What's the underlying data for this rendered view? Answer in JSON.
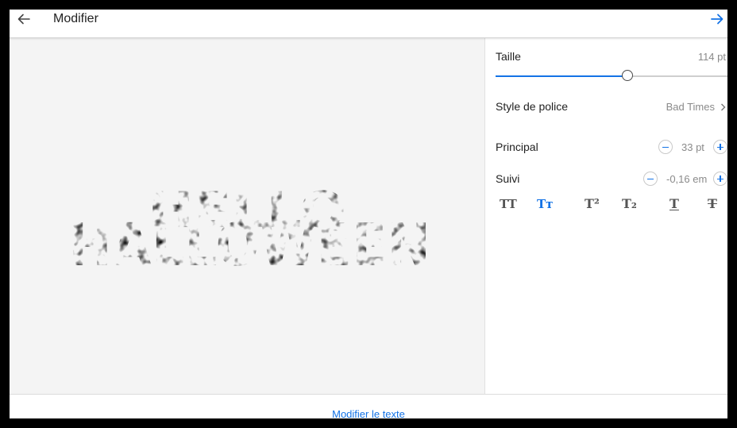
{
  "header": {
    "title": "Modifier",
    "back_icon": "arrow-left-icon",
    "forward_icon": "arrow-right-icon"
  },
  "canvas": {
    "text_line1": "HELLO",
    "text_line2": "HALLOWEEN"
  },
  "panel": {
    "size": {
      "label": "Taille",
      "value": "114 pt",
      "level_percent": 56
    },
    "font_style": {
      "label": "Style de police",
      "value": "Bad Times"
    },
    "leading": {
      "label": "Principal",
      "value": "33 pt"
    },
    "tracking": {
      "label": "Suivi",
      "value": "-0,16 em"
    },
    "text_case_options": [
      {
        "name": "all-caps-icon",
        "glyph": "TT",
        "active": false
      },
      {
        "name": "small-caps-icon",
        "glyph": "Tт",
        "active": true
      },
      {
        "name": "superscript-icon",
        "glyph": "T²",
        "active": false
      },
      {
        "name": "subscript-icon",
        "glyph": "T₂",
        "active": false
      },
      {
        "name": "underline-icon",
        "glyph": "T",
        "active": false
      },
      {
        "name": "strikethrough-icon",
        "glyph": "T",
        "active": false
      }
    ]
  },
  "footer": {
    "edit_text_label": "Modifier le texte"
  },
  "colors": {
    "accent": "#1473e6",
    "canvas_bg": "#f4f4f4",
    "text_dark": "#222222",
    "text_muted": "#8a8a8a"
  }
}
